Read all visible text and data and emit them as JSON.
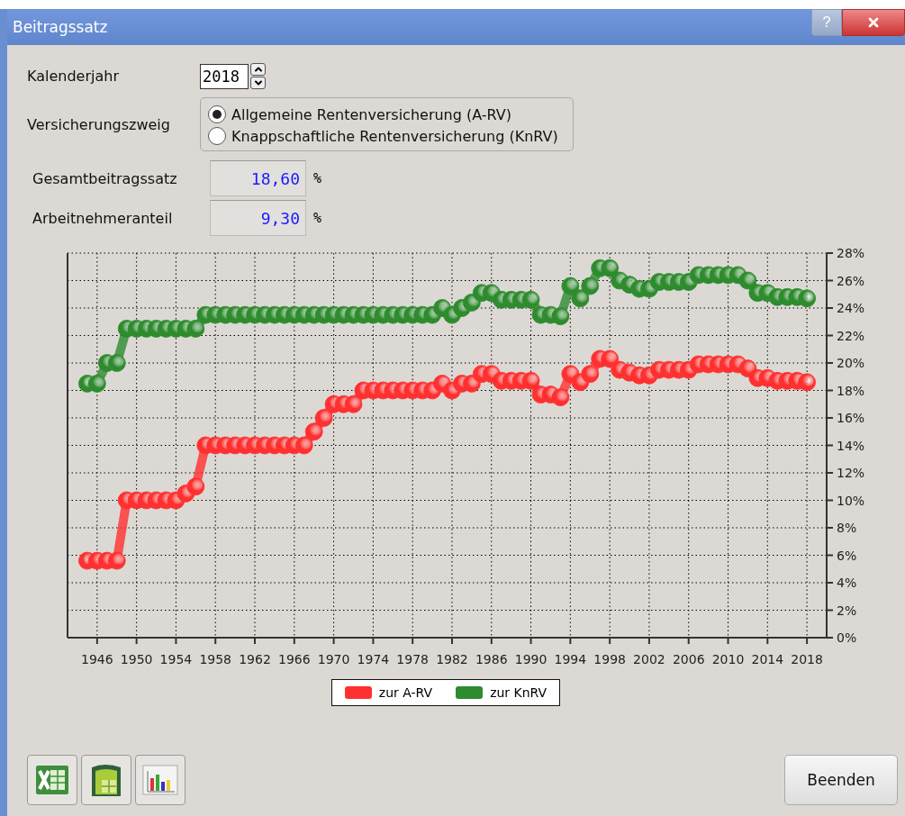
{
  "window": {
    "title": "Beitragssatz",
    "help": "?"
  },
  "year": {
    "label": "Kalenderjahr",
    "value": "2018"
  },
  "branch": {
    "label": "Versicherungszweig",
    "options": [
      {
        "label": "Allgemeine Rentenversicherung (A-RV)",
        "selected": true
      },
      {
        "label": "Knappschaftliche Rentenversicherung (KnRV)",
        "selected": false
      }
    ]
  },
  "rates": [
    {
      "label": "Gesamtbeitragssatz",
      "value": "18,60",
      "unit": "%"
    },
    {
      "label": "Arbeitnehmeranteil",
      "value": "9,30",
      "unit": "%"
    }
  ],
  "chart_data": {
    "type": "line",
    "grid": true,
    "xlim": [
      1943,
      2020
    ],
    "ylim": [
      0,
      28
    ],
    "x": [
      1945,
      1946,
      1947,
      1948,
      1949,
      1950,
      1951,
      1952,
      1953,
      1954,
      1955,
      1956,
      1957,
      1958,
      1959,
      1960,
      1961,
      1962,
      1963,
      1964,
      1965,
      1966,
      1967,
      1968,
      1969,
      1970,
      1971,
      1972,
      1973,
      1974,
      1975,
      1976,
      1977,
      1978,
      1979,
      1980,
      1981,
      1982,
      1983,
      1984,
      1985,
      1986,
      1987,
      1988,
      1989,
      1990,
      1991,
      1992,
      1993,
      1994,
      1995,
      1996,
      1997,
      1998,
      1999,
      2000,
      2001,
      2002,
      2003,
      2004,
      2005,
      2006,
      2007,
      2008,
      2009,
      2010,
      2011,
      2012,
      2013,
      2014,
      2015,
      2016,
      2017,
      2018
    ],
    "xticks": [
      1946,
      1950,
      1954,
      1958,
      1962,
      1966,
      1970,
      1974,
      1978,
      1982,
      1986,
      1990,
      1994,
      1998,
      2002,
      2006,
      2010,
      2014,
      2018
    ],
    "yticks": [
      {
        "value": 0,
        "label": "0%"
      },
      {
        "value": 2,
        "label": "2%"
      },
      {
        "value": 4,
        "label": "4%"
      },
      {
        "value": 6,
        "label": "6%"
      },
      {
        "value": 8,
        "label": "8%"
      },
      {
        "value": 10,
        "label": "10%"
      },
      {
        "value": 12,
        "label": "12%"
      },
      {
        "value": 14,
        "label": "14%"
      },
      {
        "value": 16,
        "label": "16%"
      },
      {
        "value": 18,
        "label": "18%"
      },
      {
        "value": 20,
        "label": "20%"
      },
      {
        "value": 22,
        "label": "22%"
      },
      {
        "value": 24,
        "label": "24%"
      },
      {
        "value": 26,
        "label": "26%"
      },
      {
        "value": 28,
        "label": "28%"
      }
    ],
    "series": [
      {
        "name": "zur A-RV",
        "color": "#ff3030",
        "marker": "circle",
        "values": [
          5.6,
          5.6,
          5.6,
          5.6,
          10,
          10,
          10,
          10,
          10,
          10,
          10.5,
          11,
          14,
          14,
          14,
          14,
          14,
          14,
          14,
          14,
          14,
          14,
          14,
          15,
          16,
          17,
          17,
          17,
          18,
          18,
          18,
          18,
          18,
          18,
          18,
          18,
          18.5,
          18,
          18.5,
          18.5,
          19.2,
          19.2,
          18.7,
          18.7,
          18.7,
          18.7,
          17.7,
          17.7,
          17.5,
          19.2,
          18.6,
          19.2,
          20.3,
          20.3,
          19.5,
          19.3,
          19.1,
          19.1,
          19.5,
          19.5,
          19.5,
          19.5,
          19.9,
          19.9,
          19.9,
          19.9,
          19.9,
          19.6,
          18.9,
          18.9,
          18.7,
          18.7,
          18.7,
          18.6
        ]
      },
      {
        "name": "zur KnRV",
        "color": "#2e8b2e",
        "marker": "circle",
        "values": [
          18.5,
          18.5,
          20,
          20,
          22.5,
          22.5,
          22.5,
          22.5,
          22.5,
          22.5,
          22.5,
          22.5,
          23.5,
          23.5,
          23.5,
          23.5,
          23.5,
          23.5,
          23.5,
          23.5,
          23.5,
          23.5,
          23.5,
          23.5,
          23.5,
          23.5,
          23.5,
          23.5,
          23.5,
          23.5,
          23.5,
          23.5,
          23.5,
          23.5,
          23.5,
          23.5,
          24,
          23.5,
          24,
          24.4,
          25.1,
          25.1,
          24.6,
          24.6,
          24.6,
          24.6,
          23.5,
          23.5,
          23.4,
          25.6,
          24.7,
          25.6,
          26.9,
          26.9,
          26,
          25.7,
          25.4,
          25.4,
          25.9,
          25.9,
          25.9,
          25.9,
          26.4,
          26.4,
          26.4,
          26.4,
          26.4,
          26,
          25.1,
          25.1,
          24.8,
          24.8,
          24.8,
          24.7
        ]
      }
    ]
  },
  "buttons": {
    "close": "Beenden"
  }
}
